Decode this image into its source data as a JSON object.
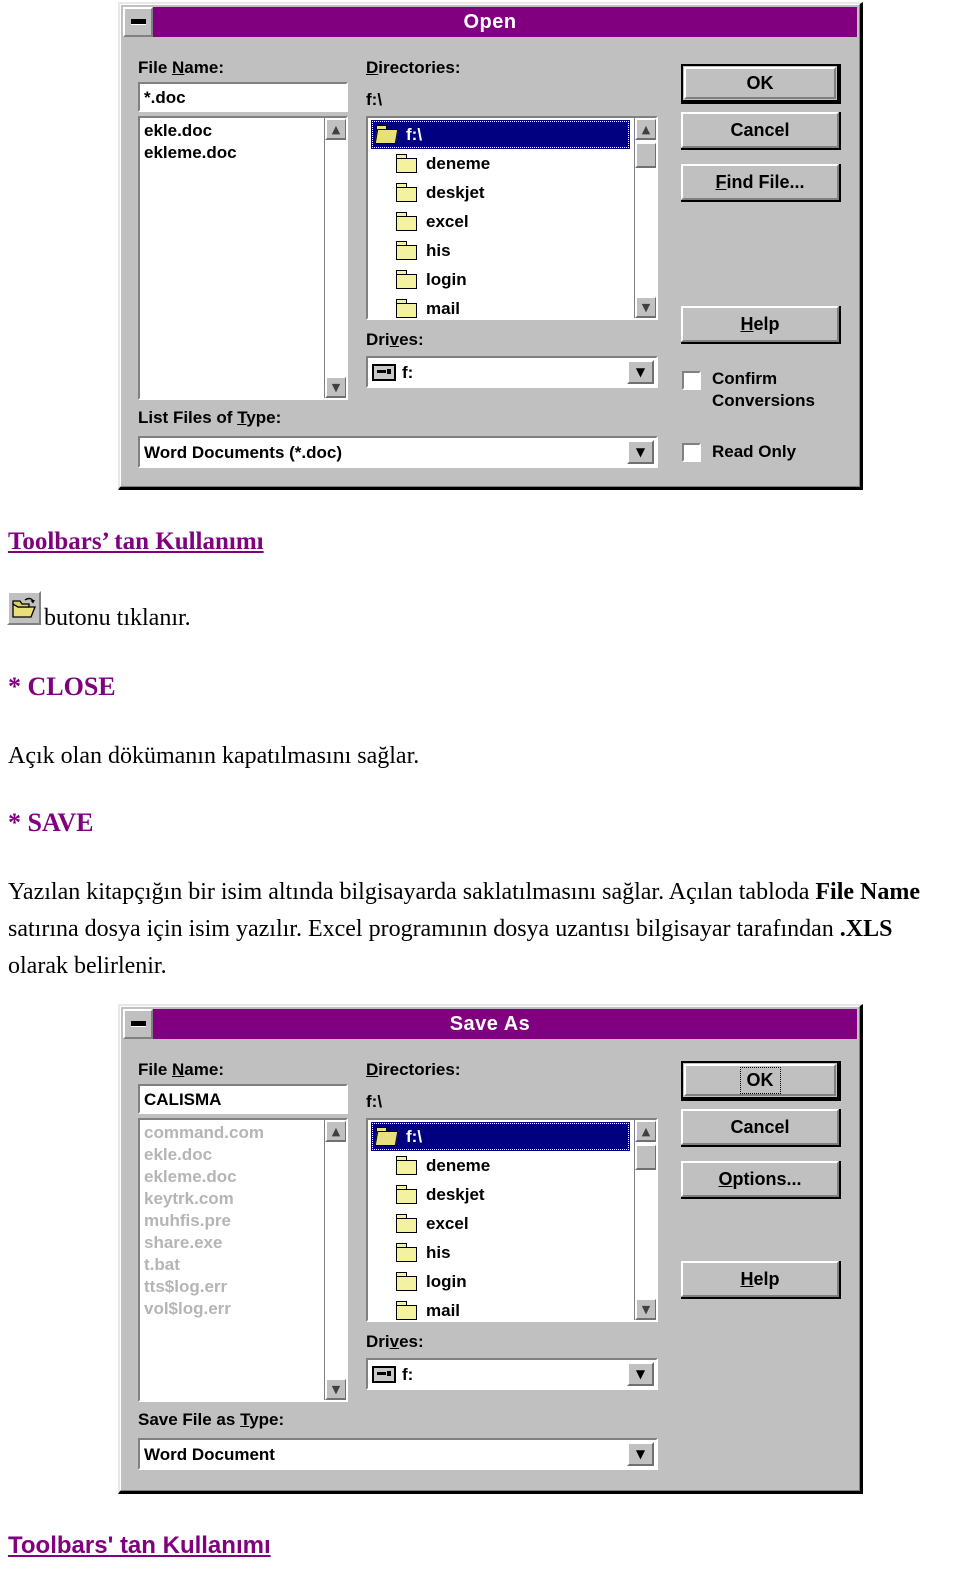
{
  "page": {
    "heading": "Toolbars’ tan Kullanımı",
    "icon_caption": "butonu tıklanır.",
    "close_heading": "* CLOSE",
    "close_body": "Açık olan dökümanın kapatılmasını sağlar.",
    "save_heading": "* SAVE",
    "save_body_1": "Yazılan kitapçığın bir isim altında bilgisayarda saklatılmasını sağlar. Açılan tabloda ",
    "save_body_bold_1": "File Name",
    "save_body_2": " satırına dosya için isim yazılır. Excel programının dosya uzantısı bilgisayar tarafından ",
    "save_body_bold_2": ".XLS",
    "save_body_3": " olarak belirlenir.",
    "footer_heading": "Toolbars' tan Kullanımı",
    "accent_color": "#800080",
    "selection_color": "#000080",
    "face_color": "#c0c0c0"
  },
  "open_dialog": {
    "title": "Open",
    "minimize_icon": "minimize-icon",
    "file_name_label": "File Name:",
    "file_name_value": "*.doc",
    "file_list": [
      "ekle.doc",
      "ekleme.doc"
    ],
    "directories_label": "Directories:",
    "current_path": "f:\\",
    "tree": [
      {
        "label": "f:\\",
        "icon": "folder-open-icon",
        "selected": true
      },
      {
        "label": "deneme",
        "icon": "folder-icon",
        "selected": false
      },
      {
        "label": "deskjet",
        "icon": "folder-icon",
        "selected": false
      },
      {
        "label": "excel",
        "icon": "folder-icon",
        "selected": false
      },
      {
        "label": "his",
        "icon": "folder-icon",
        "selected": false
      },
      {
        "label": "login",
        "icon": "folder-icon",
        "selected": false
      },
      {
        "label": "mail",
        "icon": "folder-icon",
        "selected": false
      }
    ],
    "drives_label": "Drives:",
    "drives_value": "f:",
    "list_files_label": "List Files of Type:",
    "list_files_value": "Word Documents (*.doc)",
    "buttons": {
      "ok": "OK",
      "cancel": "Cancel",
      "find_file": "Find File...",
      "help": "Help"
    },
    "checkboxes": [
      {
        "label_line1": "Confirm",
        "label_line2": "Conversions",
        "checked": false
      },
      {
        "label_line1": "Read Only",
        "label_line2": "",
        "checked": false
      }
    ],
    "scroll_up_glyph": "▲",
    "scroll_down_glyph": "▼",
    "combo_arrow_glyph": "▼"
  },
  "saveas_dialog": {
    "title": "Save As",
    "minimize_icon": "minimize-icon",
    "file_name_label": "File Name:",
    "file_name_value": "CALISMA",
    "file_list": [
      "command.com",
      "ekle.doc",
      "ekleme.doc",
      "keytrk.com",
      "muhfis.pre",
      "share.exe",
      "t.bat",
      "tts$log.err",
      "vol$log.err"
    ],
    "directories_label": "Directories:",
    "current_path": "f:\\",
    "tree": [
      {
        "label": "f:\\",
        "icon": "folder-open-icon",
        "selected": true
      },
      {
        "label": "deneme",
        "icon": "folder-icon",
        "selected": false
      },
      {
        "label": "deskjet",
        "icon": "folder-icon",
        "selected": false
      },
      {
        "label": "excel",
        "icon": "folder-icon",
        "selected": false
      },
      {
        "label": "his",
        "icon": "folder-icon",
        "selected": false
      },
      {
        "label": "login",
        "icon": "folder-icon",
        "selected": false
      },
      {
        "label": "mail",
        "icon": "folder-icon",
        "selected": false
      }
    ],
    "drives_label": "Drives:",
    "drives_value": "f:",
    "save_type_label": "Save File as Type:",
    "save_type_value": "Word Document",
    "buttons": {
      "ok": "OK",
      "cancel": "Cancel",
      "options": "Options...",
      "help": "Help"
    }
  }
}
